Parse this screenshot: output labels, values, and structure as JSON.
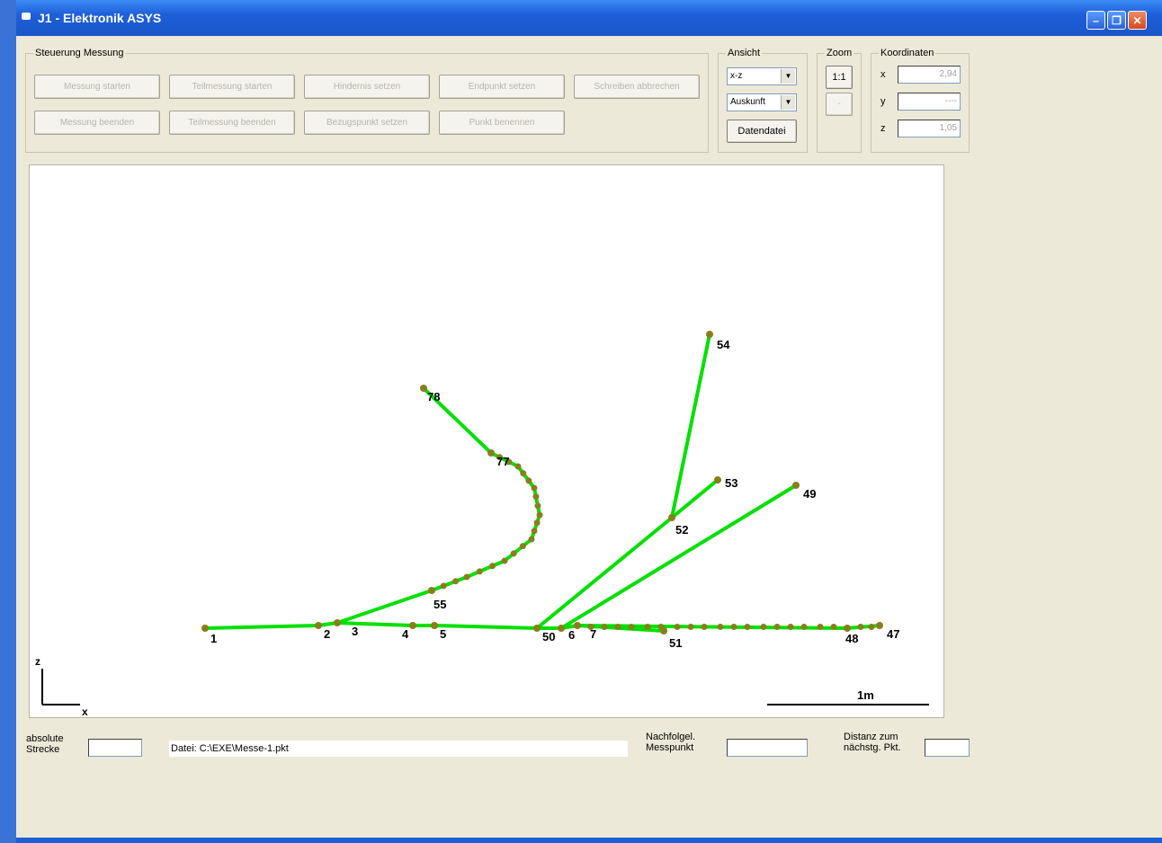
{
  "window": {
    "title": "J1 - Elektronik   ASYS"
  },
  "groups": {
    "steuerung": {
      "legend": "Steuerung Messung",
      "row1": [
        "Messung starten",
        "Teilmessung starten",
        "Hindernis setzen",
        "Endpunkt setzen",
        "Schreiben abbrechen"
      ],
      "row2": [
        "Messung beenden",
        "Teilmessung beenden",
        "Bezugspunkt setzen",
        "Punkt benennen"
      ]
    },
    "ansicht": {
      "legend": "Ansicht",
      "view_select": "x-z",
      "mode_select": "Auskunft",
      "datafile_button": "Datendatei"
    },
    "zoom": {
      "legend": "Zoom",
      "btn_11": "1:1",
      "btn_minus": "-"
    },
    "koordinaten": {
      "legend": "Koordinaten",
      "x_label": "x",
      "x_value": "2,94",
      "y_label": "y",
      "y_value": "----",
      "z_label": "z",
      "z_value": "1,05"
    }
  },
  "footer": {
    "abs_label": "absolute\nStrecke",
    "abs_value": "",
    "file_label": "Datei: C:\\EXE\\Messe-1.pkt",
    "next_label": "Nachfolgel.\nMesspunkt",
    "next_value": "",
    "dist_label": "Distanz zum\nnächstg. Pkt.",
    "dist_value": ""
  },
  "colors": {
    "line": "#00e000",
    "point": "#8b7d1c",
    "accent_title": "#1b55c8"
  },
  "chart_data": {
    "type": "scatter",
    "xlabel": "x",
    "ylabel": "z",
    "scale_label": "1m",
    "scale_length_m": 1,
    "xlim": [
      0,
      3.4
    ],
    "ylim": [
      0,
      2.1
    ],
    "points": [
      {
        "id": "1",
        "x": 0.65,
        "z": 0.33,
        "label": "1"
      },
      {
        "id": "2",
        "x": 1.07,
        "z": 0.34,
        "label": "2"
      },
      {
        "id": "3",
        "x": 1.14,
        "z": 0.35,
        "label": "3"
      },
      {
        "id": "4",
        "x": 1.42,
        "z": 0.34,
        "label": "4"
      },
      {
        "id": "5",
        "x": 1.5,
        "z": 0.34,
        "label": "5"
      },
      {
        "id": "50",
        "x": 1.88,
        "z": 0.33,
        "label": "50"
      },
      {
        "id": "6",
        "x": 1.97,
        "z": 0.33,
        "label": "6"
      },
      {
        "id": "7",
        "x": 2.03,
        "z": 0.34,
        "label": "7"
      },
      {
        "id": "51",
        "x": 2.35,
        "z": 0.32,
        "label": "51"
      },
      {
        "id": "48",
        "x": 3.03,
        "z": 0.33,
        "label": "48"
      },
      {
        "id": "47",
        "x": 3.15,
        "z": 0.34,
        "label": "47"
      },
      {
        "id": "55",
        "x": 1.49,
        "z": 0.47,
        "label": "55"
      },
      {
        "id": "77",
        "x": 1.71,
        "z": 0.98,
        "label": "77"
      },
      {
        "id": "78",
        "x": 1.46,
        "z": 1.22,
        "label": "78"
      },
      {
        "id": "52",
        "x": 2.38,
        "z": 0.74,
        "label": "52"
      },
      {
        "id": "53",
        "x": 2.55,
        "z": 0.88,
        "label": "53"
      },
      {
        "id": "49",
        "x": 2.84,
        "z": 0.86,
        "label": "49"
      },
      {
        "id": "54",
        "x": 2.52,
        "z": 1.42,
        "label": "54"
      }
    ],
    "segments": [
      [
        "1",
        "2"
      ],
      [
        "2",
        "3"
      ],
      [
        "3",
        "4"
      ],
      [
        "4",
        "5"
      ],
      [
        "5",
        "50"
      ],
      [
        "50",
        "6"
      ],
      [
        "6",
        "7"
      ],
      [
        "7",
        "51"
      ],
      [
        "7",
        "48"
      ],
      [
        "48",
        "47"
      ],
      [
        "3",
        "55"
      ],
      [
        "50",
        "52"
      ],
      [
        "52",
        "53"
      ],
      [
        "52",
        "54"
      ],
      [
        "6",
        "49"
      ],
      [
        "77",
        "78"
      ]
    ],
    "curve_55_77": [
      [
        1.49,
        0.47
      ],
      [
        1.62,
        0.52
      ],
      [
        1.76,
        0.58
      ],
      [
        1.86,
        0.66
      ],
      [
        1.89,
        0.75
      ],
      [
        1.87,
        0.85
      ],
      [
        1.81,
        0.93
      ],
      [
        1.71,
        0.98
      ]
    ],
    "baseline_dots_x": [
      2.08,
      2.13,
      2.18,
      2.23,
      2.29,
      2.34,
      2.4,
      2.45,
      2.5,
      2.56,
      2.61,
      2.66,
      2.72,
      2.77,
      2.82,
      2.87,
      2.93,
      2.98,
      3.08,
      3.12
    ]
  }
}
